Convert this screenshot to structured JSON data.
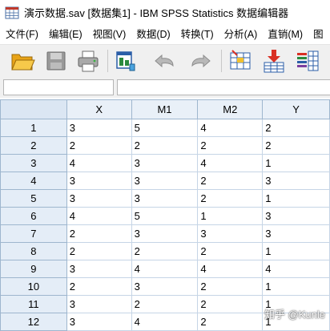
{
  "window": {
    "title": "演示数据.sav [数据集1] - IBM SPSS Statistics 数据编辑器"
  },
  "menu": [
    {
      "label": "文件(F)"
    },
    {
      "label": "编辑(E)"
    },
    {
      "label": "视图(V)"
    },
    {
      "label": "数据(D)"
    },
    {
      "label": "转换(T)"
    },
    {
      "label": "分析(A)"
    },
    {
      "label": "直销(M)"
    },
    {
      "label": "图"
    }
  ],
  "toolbar": {
    "icons": [
      "open-folder-icon",
      "save-icon",
      "print-icon",
      "dialog-recall-icon",
      "undo-icon",
      "redo-icon",
      "go-to-case-icon",
      "insert-cases-icon",
      "variables-icon"
    ]
  },
  "editbar": {
    "cell_ref": "",
    "cell_value": ""
  },
  "grid": {
    "columns": [
      "X",
      "M1",
      "M2",
      "Y"
    ],
    "rows": [
      {
        "n": "1",
        "v": [
          "3",
          "5",
          "4",
          "2"
        ]
      },
      {
        "n": "2",
        "v": [
          "2",
          "2",
          "2",
          "2"
        ]
      },
      {
        "n": "3",
        "v": [
          "4",
          "3",
          "4",
          "1"
        ]
      },
      {
        "n": "4",
        "v": [
          "3",
          "3",
          "2",
          "3"
        ]
      },
      {
        "n": "5",
        "v": [
          "3",
          "3",
          "2",
          "1"
        ]
      },
      {
        "n": "6",
        "v": [
          "4",
          "5",
          "1",
          "3"
        ]
      },
      {
        "n": "7",
        "v": [
          "2",
          "3",
          "3",
          "3"
        ]
      },
      {
        "n": "8",
        "v": [
          "2",
          "2",
          "2",
          "1"
        ]
      },
      {
        "n": "9",
        "v": [
          "3",
          "4",
          "4",
          "4"
        ]
      },
      {
        "n": "10",
        "v": [
          "2",
          "3",
          "2",
          "1"
        ]
      },
      {
        "n": "11",
        "v": [
          "3",
          "2",
          "2",
          "1"
        ]
      },
      {
        "n": "12",
        "v": [
          "3",
          "4",
          "2",
          "1"
        ]
      }
    ]
  },
  "watermark": {
    "text": "知乎 @Kunle"
  },
  "colors": {
    "header_bg": "#e9f0f8",
    "grid_line": "#c6d5e6",
    "toolbar_bg": "#f0f0f0"
  }
}
